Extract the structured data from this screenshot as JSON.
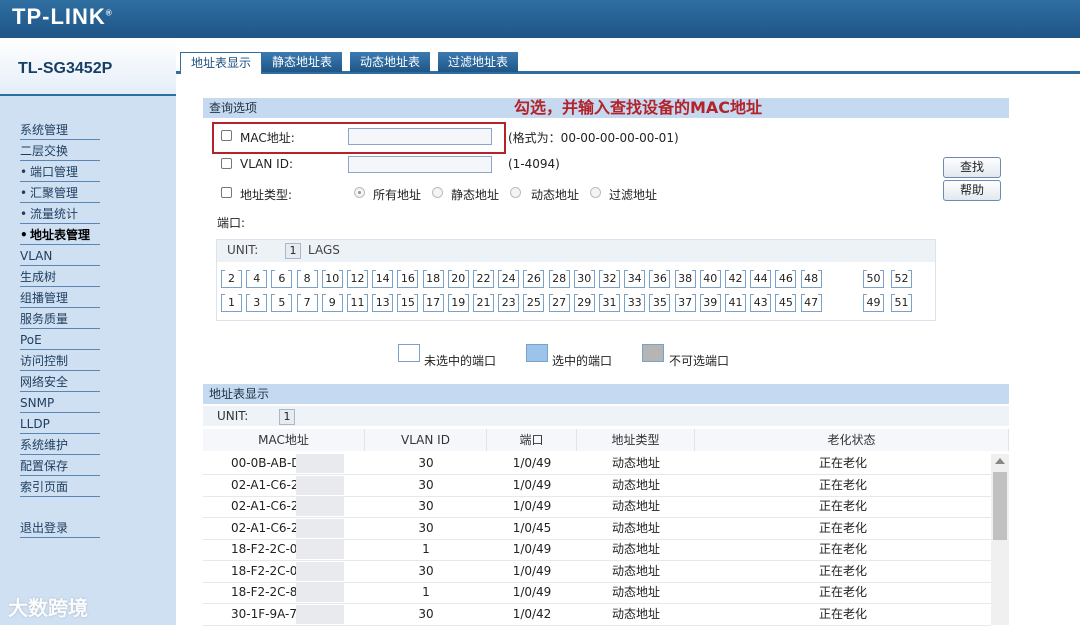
{
  "header": {
    "brand": "TP-LINK",
    "registered": "®"
  },
  "model": "TL-SG3452P",
  "sidebar": {
    "items": [
      {
        "label": "系统管理",
        "bullet": ""
      },
      {
        "label": "二层交换",
        "bullet": ""
      },
      {
        "label": "端口管理",
        "bullet": "•"
      },
      {
        "label": "汇聚管理",
        "bullet": "•"
      },
      {
        "label": "流量统计",
        "bullet": "•"
      },
      {
        "label": "地址表管理",
        "bullet": "•",
        "active": true
      },
      {
        "label": "VLAN",
        "bullet": ""
      },
      {
        "label": "生成树",
        "bullet": ""
      },
      {
        "label": "组播管理",
        "bullet": ""
      },
      {
        "label": "服务质量",
        "bullet": ""
      },
      {
        "label": "PoE",
        "bullet": ""
      },
      {
        "label": "访问控制",
        "bullet": ""
      },
      {
        "label": "网络安全",
        "bullet": ""
      },
      {
        "label": "SNMP",
        "bullet": ""
      },
      {
        "label": "LLDP",
        "bullet": ""
      },
      {
        "label": "系统维护",
        "bullet": ""
      },
      {
        "label": "配置保存",
        "bullet": ""
      },
      {
        "label": "索引页面",
        "bullet": ""
      }
    ],
    "logout": "退出登录",
    "watermark": "大数跨境"
  },
  "tabs": [
    "地址表显示",
    "静态地址表",
    "动态地址表",
    "过滤地址表"
  ],
  "query": {
    "title": "查询选项",
    "annotation": "勾选，并输入查找设备的MAC地址",
    "mac_label": "MAC地址:",
    "mac_value": "",
    "mac_hint": "(格式为：00-00-00-00-00-01)",
    "vlan_label": "VLAN ID:",
    "vlan_value": "",
    "vlan_hint": "(1-4094)",
    "type_label": "地址类型:",
    "type_options": [
      "所有地址",
      "静态地址",
      "动态地址",
      "过滤地址"
    ],
    "port_label": "端口:",
    "search_btn": "查找",
    "help_btn": "帮助"
  },
  "ports": {
    "unit_label": "UNIT:",
    "unit_value": "1",
    "lags_label": "LAGS",
    "top_row": [
      "2",
      "4",
      "6",
      "8",
      "10",
      "12",
      "14",
      "16",
      "18",
      "20",
      "22",
      "24",
      "26",
      "28",
      "30",
      "32",
      "34",
      "36",
      "38",
      "40",
      "42",
      "44",
      "46",
      "48"
    ],
    "bottom_row": [
      "1",
      "3",
      "5",
      "7",
      "9",
      "11",
      "13",
      "15",
      "17",
      "19",
      "21",
      "23",
      "25",
      "27",
      "29",
      "31",
      "33",
      "35",
      "37",
      "39",
      "41",
      "43",
      "45",
      "47"
    ],
    "extra_top": [
      "50",
      "52"
    ],
    "extra_bottom": [
      "49",
      "51"
    ]
  },
  "legend": {
    "unselected": "未选中的端口",
    "selected": "选中的端口",
    "unavailable": "不可选端口",
    "colors": {
      "unselected": "#ffffff",
      "selected": "#9cc3ea",
      "unavailable": "#b5b5b5"
    }
  },
  "table": {
    "title": "地址表显示",
    "unit_label": "UNIT:",
    "unit_value": "1",
    "columns": [
      "MAC地址",
      "VLAN ID",
      "端口",
      "地址类型",
      "老化状态"
    ],
    "rows": [
      [
        "00-0B-AB-D",
        "30",
        "1/0/49",
        "动态地址",
        "正在老化"
      ],
      [
        "02-A1-C6-2",
        "30",
        "1/0/49",
        "动态地址",
        "正在老化"
      ],
      [
        "02-A1-C6-2",
        "30",
        "1/0/49",
        "动态地址",
        "正在老化"
      ],
      [
        "02-A1-C6-2",
        "30",
        "1/0/45",
        "动态地址",
        "正在老化"
      ],
      [
        "18-F2-2C-0",
        "1",
        "1/0/49",
        "动态地址",
        "正在老化"
      ],
      [
        "18-F2-2C-0",
        "30",
        "1/0/49",
        "动态地址",
        "正在老化"
      ],
      [
        "18-F2-2C-8",
        "1",
        "1/0/49",
        "动态地址",
        "正在老化"
      ],
      [
        "30-1F-9A-7",
        "30",
        "1/0/42",
        "动态地址",
        "正在老化"
      ]
    ]
  }
}
